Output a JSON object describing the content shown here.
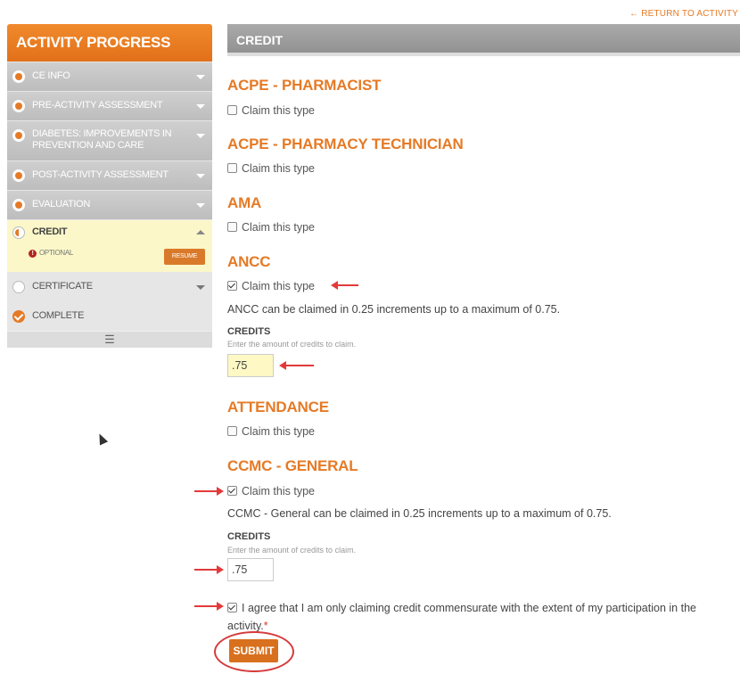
{
  "return_link": "← RETURN TO ACTIVITY",
  "sidebar": {
    "title": "ACTIVITY PROGRESS",
    "items": [
      {
        "label": "CE INFO"
      },
      {
        "label": "PRE-ACTIVITY ASSESSMENT"
      },
      {
        "label": "DIABETES: IMPROVEMENTS IN PREVENTION AND CARE"
      },
      {
        "label": "POST-ACTIVITY ASSESSMENT"
      },
      {
        "label": "EVALUATION"
      },
      {
        "label": "CREDIT",
        "optional": "OPTIONAL",
        "resume": "RESUME"
      },
      {
        "label": "CERTIFICATE"
      },
      {
        "label": "COMPLETE"
      }
    ],
    "footer_icon": "menu-icon"
  },
  "main": {
    "header": "CREDIT",
    "sections": [
      {
        "title": "ACPE - PHARMACIST",
        "claim": "Claim this type",
        "checked": false
      },
      {
        "title": "ACPE - PHARMACY TECHNICIAN",
        "claim": "Claim this type",
        "checked": false
      },
      {
        "title": "AMA",
        "claim": "Claim this type",
        "checked": false
      },
      {
        "title": "ANCC",
        "claim": "Claim this type",
        "checked": true,
        "info": "ANCC can be claimed in 0.25 increments up to a maximum of 0.75.",
        "credits_label": "CREDITS",
        "credits_help": "Enter the amount of credits to claim.",
        "credits_value": ".75"
      },
      {
        "title": "ATTENDANCE",
        "claim": "Claim this type",
        "checked": false
      },
      {
        "title": "CCMC - GENERAL",
        "claim": "Claim this type",
        "checked": true,
        "info": "CCMC - General can be claimed in 0.25 increments up to a maximum of 0.75.",
        "credits_label": "CREDITS",
        "credits_help": "Enter the amount of credits to claim.",
        "credits_value": ".75"
      }
    ],
    "agree_text": "I agree that I am only claiming credit commensurate with the extent of my participation in the activity.",
    "agree_required": "*",
    "submit": "SUBMIT"
  },
  "colors": {
    "accent": "#e57a26",
    "annotation": "#e23a3a"
  }
}
